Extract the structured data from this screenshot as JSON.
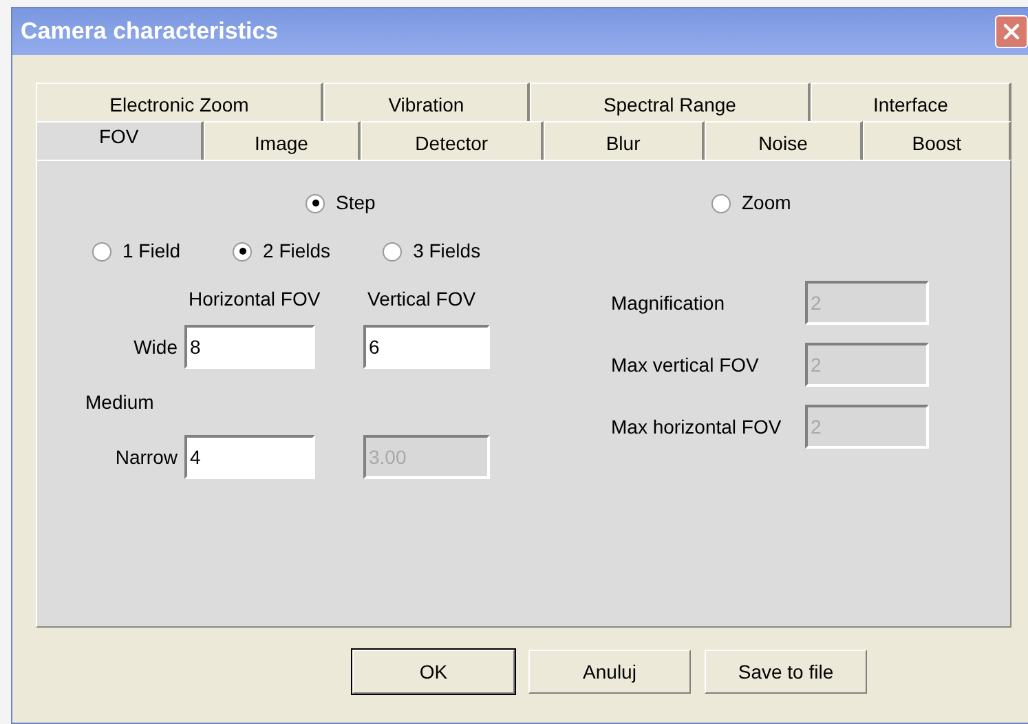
{
  "window": {
    "title": "Camera characteristics"
  },
  "tabs": {
    "back_row": [
      {
        "label": "Electronic Zoom",
        "selected": false
      },
      {
        "label": "Vibration",
        "selected": false
      },
      {
        "label": "Spectral Range",
        "selected": false
      },
      {
        "label": "Interface",
        "selected": false
      }
    ],
    "front_row": [
      {
        "label": "FOV",
        "selected": true
      },
      {
        "label": "Image",
        "selected": false
      },
      {
        "label": "Detector",
        "selected": false
      },
      {
        "label": "Blur",
        "selected": false
      },
      {
        "label": "Noise",
        "selected": false
      },
      {
        "label": "Boost",
        "selected": false
      }
    ]
  },
  "mode": [
    {
      "label": "Step",
      "selected": true
    },
    {
      "label": "Zoom",
      "selected": false
    }
  ],
  "field_count": [
    {
      "label": "1 Field",
      "selected": false
    },
    {
      "label": "2 Fields",
      "selected": true
    },
    {
      "label": "3 Fields",
      "selected": false
    }
  ],
  "step": {
    "columns": [
      "Horizontal FOV",
      "Vertical FOV"
    ],
    "rows": [
      {
        "label": "Wide",
        "fields": [
          {
            "value": "8",
            "disabled": false
          },
          {
            "value": "6",
            "disabled": false
          }
        ]
      },
      {
        "label": "Medium",
        "fields": []
      },
      {
        "label": "Narrow",
        "fields": [
          {
            "value": "4",
            "disabled": false
          },
          {
            "value": "3.00",
            "disabled": true
          }
        ]
      }
    ]
  },
  "zoom": [
    {
      "label": "Magnification",
      "value": "2",
      "disabled": true
    },
    {
      "label": "Max vertical FOV",
      "value": "2",
      "disabled": true
    },
    {
      "label": "Max horizontal FOV",
      "value": "2",
      "disabled": true
    }
  ],
  "buttons": [
    {
      "label": "OK",
      "default": true
    },
    {
      "label": "Anuluj",
      "default": false
    },
    {
      "label": "Save to file",
      "default": false
    }
  ]
}
